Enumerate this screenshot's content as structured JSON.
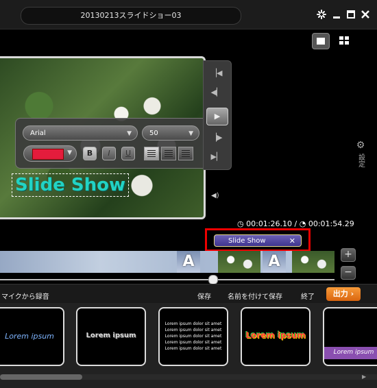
{
  "window": {
    "title": "20130213スライドショー03",
    "controls": [
      "sync-icon",
      "minimize-icon",
      "maximize-icon",
      "close-icon"
    ]
  },
  "view_modes": [
    "single-view-icon",
    "grid-view-icon"
  ],
  "preview": {
    "overlay_text": "Slide Show",
    "overlay_text_color": "#22d3c4"
  },
  "format_panel": {
    "font": "Arial",
    "size": "50",
    "color": "#e41c3c",
    "bold": "B",
    "italic": "I",
    "underline": "U",
    "alignments": [
      "align-left-icon",
      "align-center-icon",
      "align-right-icon"
    ]
  },
  "player": {
    "controls": [
      "skip-start-icon",
      "step-back-icon",
      "play-icon",
      "step-forward-icon",
      "skip-end-icon"
    ]
  },
  "settings_label": "設定",
  "timecode": {
    "current": "00:01:26.10",
    "separator": "/",
    "total": "00:01:54.29"
  },
  "selected_clip": {
    "label": "Slide Show",
    "close": "✕"
  },
  "timeline": {
    "text_clip_marker": "A"
  },
  "zoom": {
    "in": "+",
    "out": "−"
  },
  "bottom_bar": {
    "record": "マイクから録音",
    "save": "保存",
    "save_as": "名前を付けて保存",
    "exit": "終了",
    "output": "出力",
    "output_arrow": "›"
  },
  "text_styles": [
    {
      "text": "Lorem ipsum"
    },
    {
      "text": "Lorem ipsum"
    },
    {
      "text": "Lorem ipsum dolor sit amet"
    },
    {
      "text": "Lorem ipsum"
    },
    {
      "text": "Lorem ipsum"
    }
  ]
}
